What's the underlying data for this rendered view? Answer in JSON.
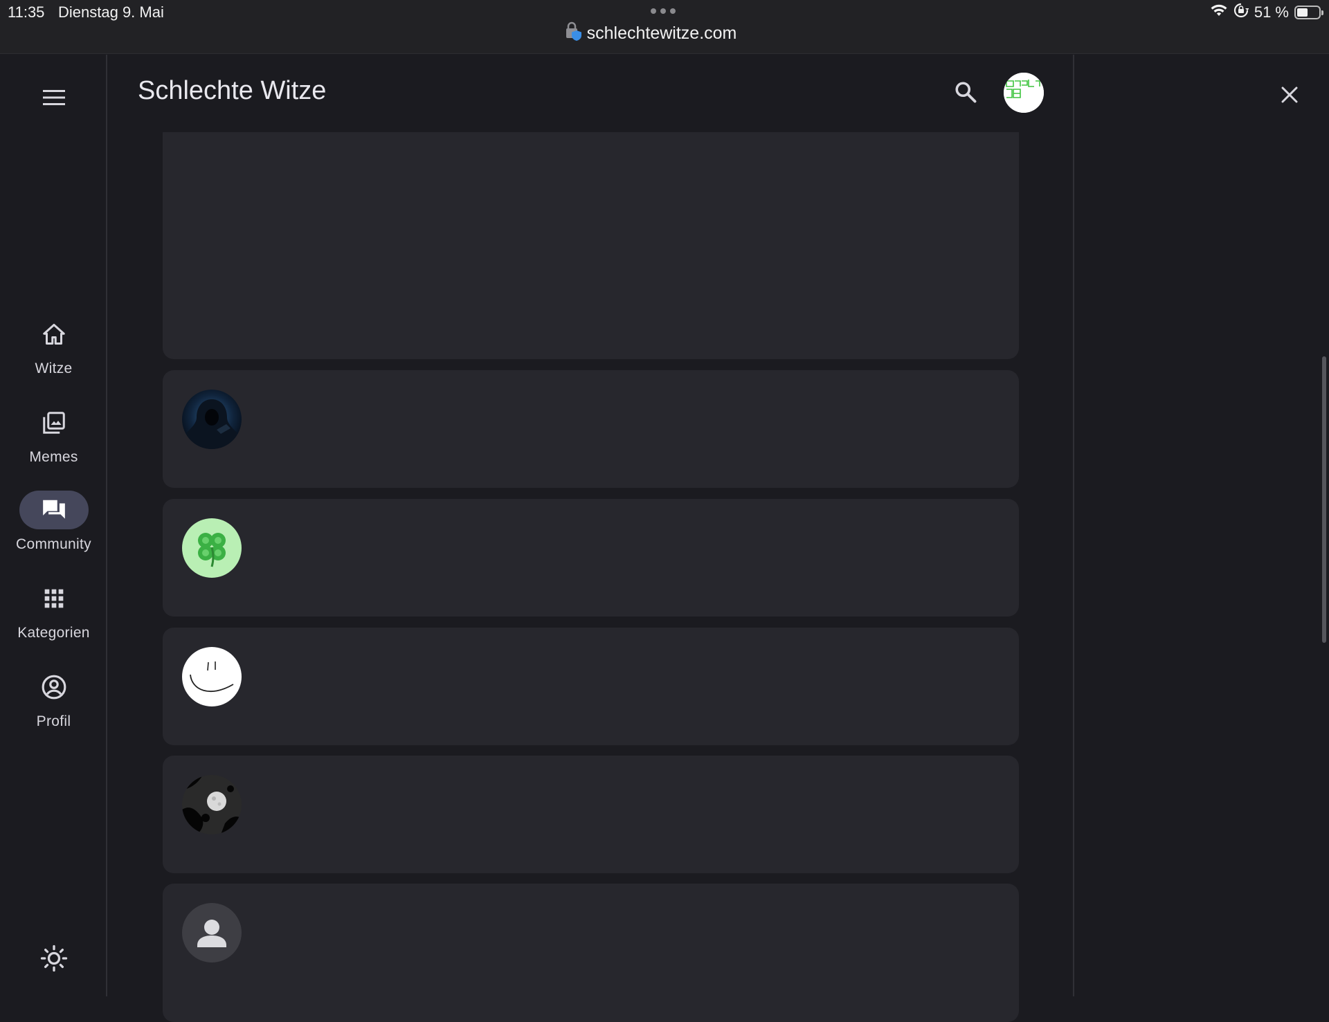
{
  "status_bar": {
    "time": "11:35",
    "date": "Dienstag 9. Mai",
    "url": "schlechtewitze.com",
    "battery": "51 %",
    "battery_level": 0.51,
    "icons": [
      "wifi-icon",
      "orientation-lock-icon",
      "battery-icon"
    ]
  },
  "header": {
    "title": "Schlechte Witze",
    "search_icon": "search-icon",
    "menu_icon": "menu-icon"
  },
  "nav": {
    "items": [
      {
        "label": "Witze",
        "icon": "home-icon",
        "active": false
      },
      {
        "label": "Memes",
        "icon": "photo-library-icon",
        "active": false
      },
      {
        "label": "Community",
        "icon": "forum-icon",
        "active": true
      },
      {
        "label": "Kategorien",
        "icon": "apps-grid-icon",
        "active": false
      },
      {
        "label": "Profil",
        "icon": "account-circle-icon",
        "active": false
      }
    ],
    "theme_icon": "light-mode-icon"
  },
  "posts": [
    {
      "avatar": "hooded-figure-avatar"
    },
    {
      "avatar": "clover-avatar"
    },
    {
      "avatar": "smiley-avatar"
    },
    {
      "avatar": "moon-avatar"
    },
    {
      "avatar": "default-person-avatar"
    }
  ],
  "colors": {
    "background": "#1b1b20",
    "card": "#27272d",
    "active_pill": "#45475b",
    "statusbar": "#222225",
    "safari_lock": "#3a8ee6"
  }
}
